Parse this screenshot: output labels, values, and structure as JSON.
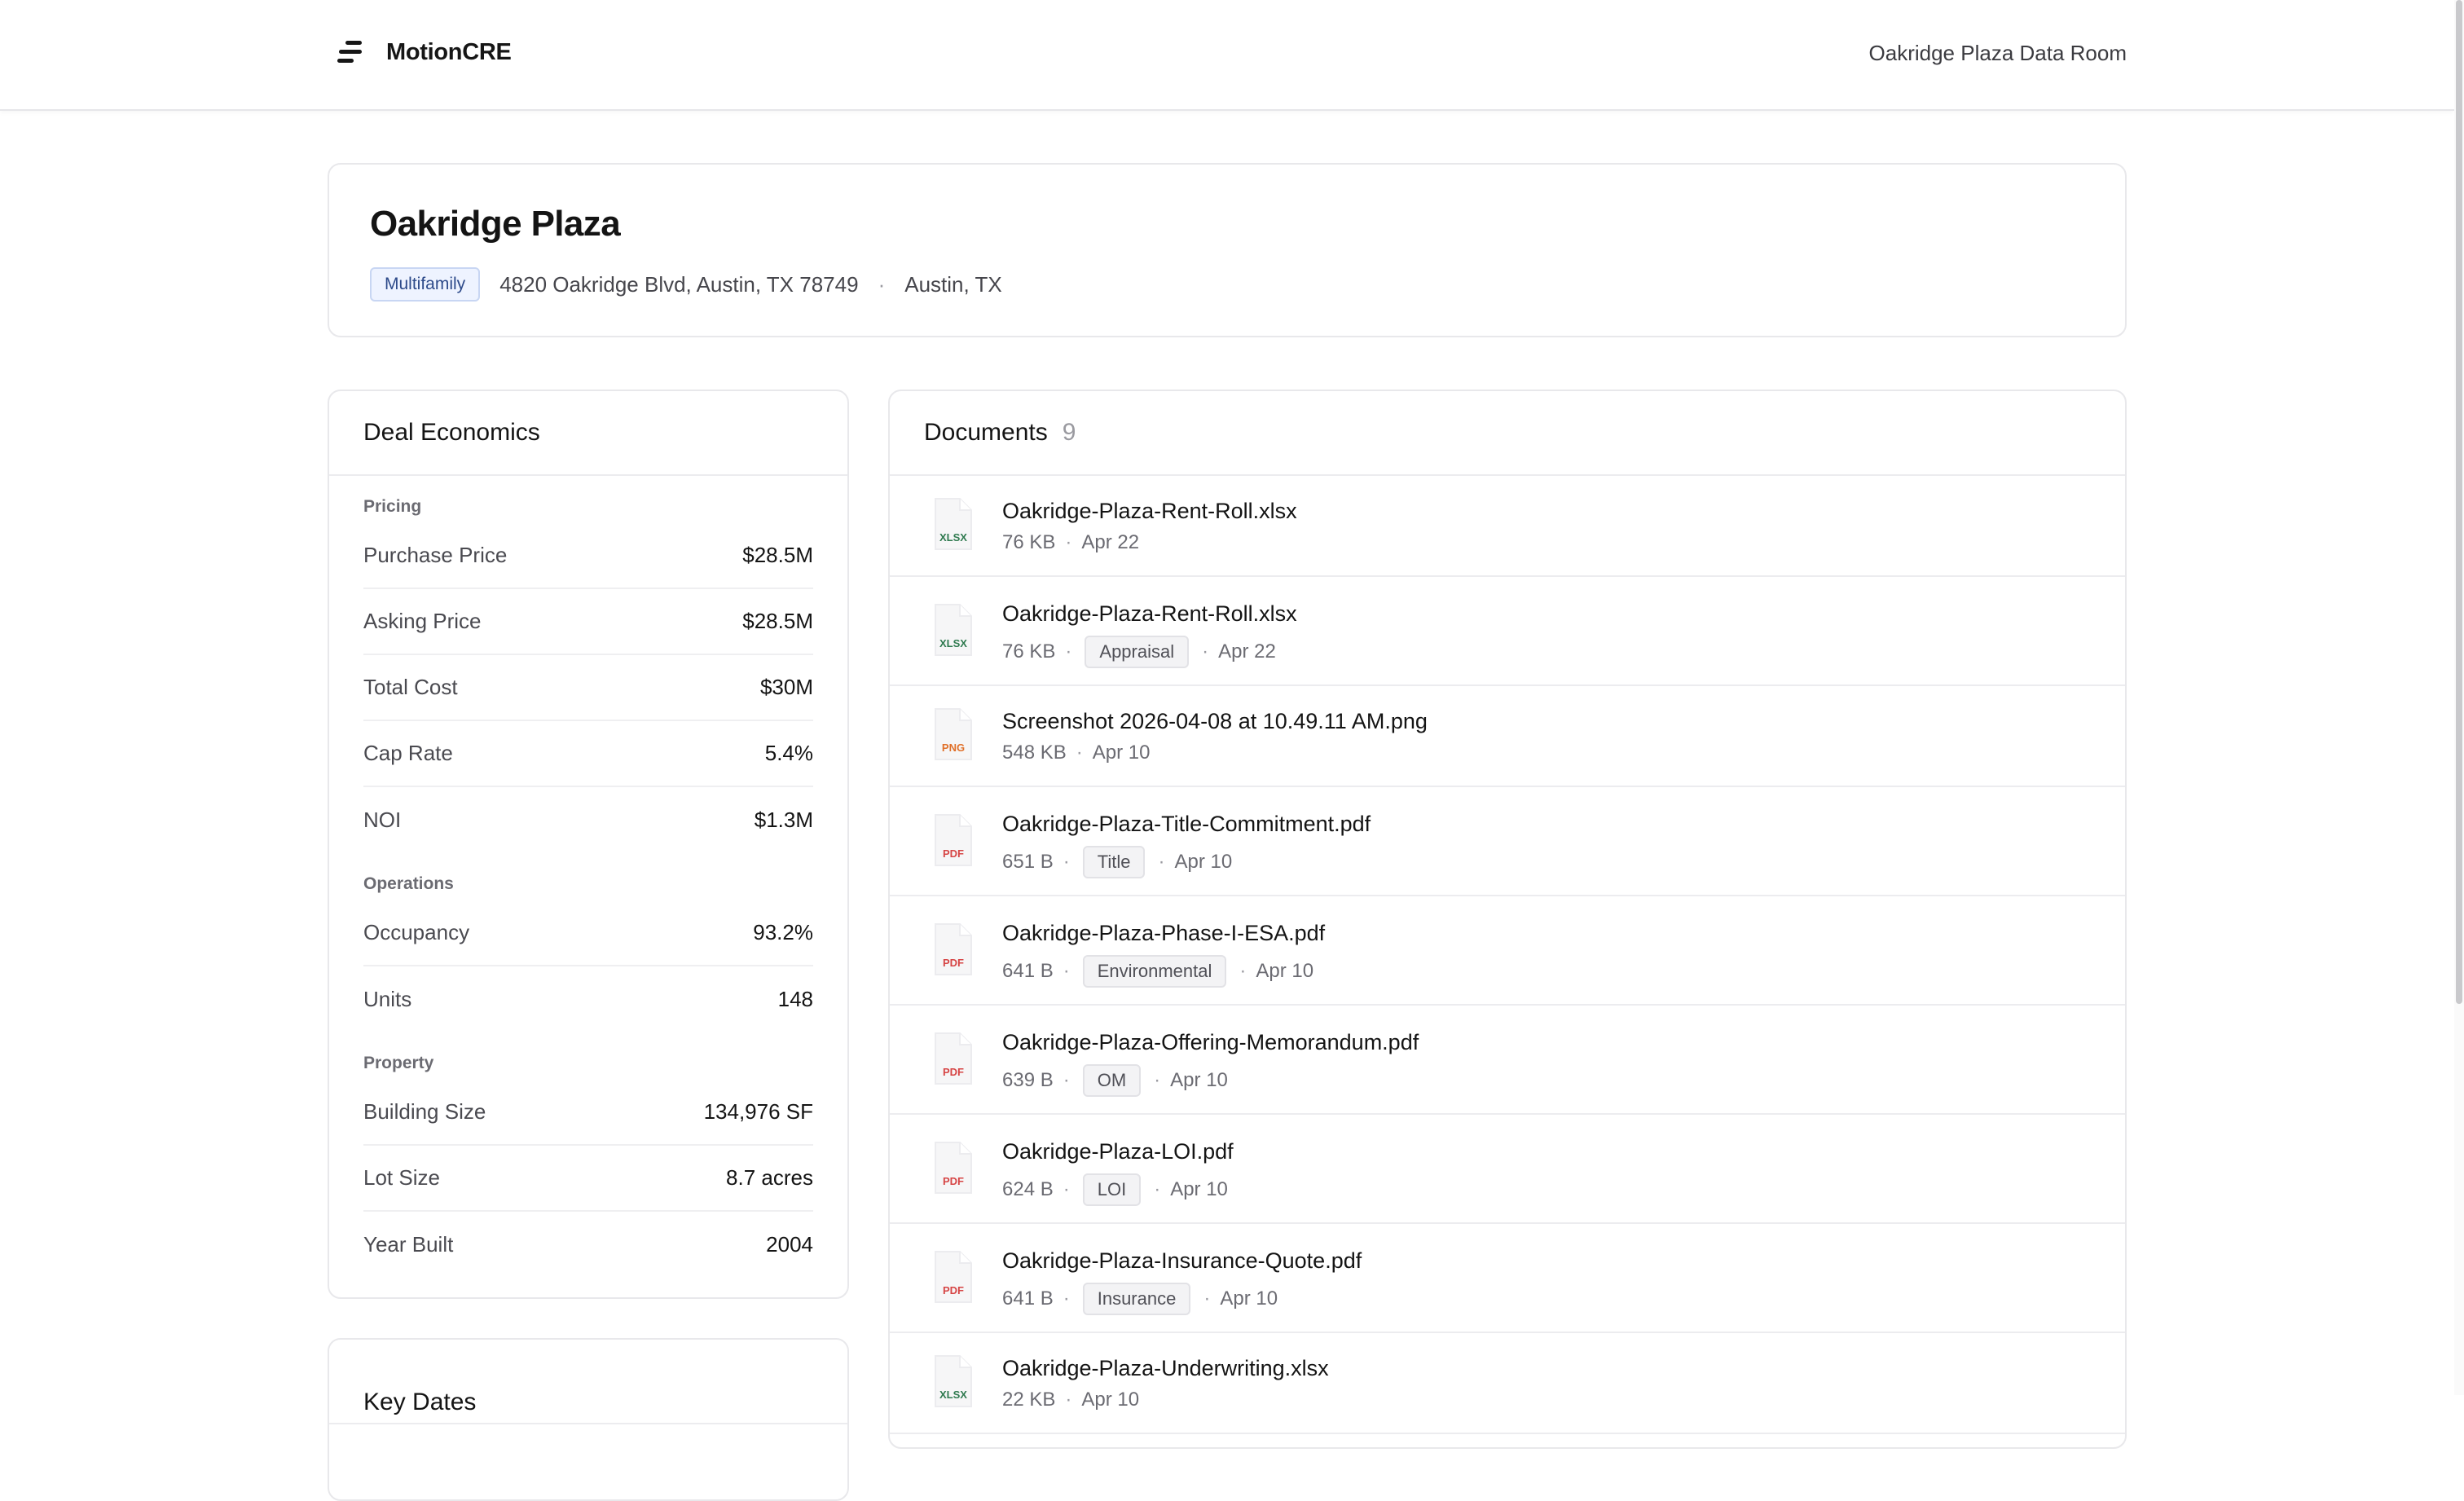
{
  "header": {
    "brand": "MotionCRE",
    "room_title": "Oakridge Plaza Data Room"
  },
  "property": {
    "name": "Oakridge Plaza",
    "type": "Multifamily",
    "address": "4820 Oakridge Blvd, Austin, TX 78749",
    "city": "Austin, TX"
  },
  "deal_economics": {
    "title": "Deal Economics",
    "sections": [
      {
        "label": "Pricing",
        "rows": [
          {
            "label": "Purchase Price",
            "value": "$28.5M"
          },
          {
            "label": "Asking Price",
            "value": "$28.5M"
          },
          {
            "label": "Total Cost",
            "value": "$30M"
          },
          {
            "label": "Cap Rate",
            "value": "5.4%"
          },
          {
            "label": "NOI",
            "value": "$1.3M"
          }
        ]
      },
      {
        "label": "Operations",
        "rows": [
          {
            "label": "Occupancy",
            "value": "93.2%"
          },
          {
            "label": "Units",
            "value": "148"
          }
        ]
      },
      {
        "label": "Property",
        "rows": [
          {
            "label": "Building Size",
            "value": "134,976 SF"
          },
          {
            "label": "Lot Size",
            "value": "8.7 acres"
          },
          {
            "label": "Year Built",
            "value": "2004"
          }
        ]
      }
    ]
  },
  "key_dates": {
    "title": "Key Dates"
  },
  "documents": {
    "title": "Documents",
    "count": "9",
    "items": [
      {
        "name": "Oakridge-Plaza-Rent-Roll.xlsx",
        "size": "76 KB",
        "tag": "",
        "date": "Apr 22",
        "ext": "XLSX",
        "icon": "xlsx-file-icon"
      },
      {
        "name": "Oakridge-Plaza-Rent-Roll.xlsx",
        "size": "76 KB",
        "tag": "Appraisal",
        "date": "Apr 22",
        "ext": "XLSX",
        "icon": "xlsx-file-icon"
      },
      {
        "name": "Screenshot 2026-04-08 at 10.49.11 AM.png",
        "size": "548 KB",
        "tag": "",
        "date": "Apr 10",
        "ext": "PNG",
        "icon": "png-file-icon"
      },
      {
        "name": "Oakridge-Plaza-Title-Commitment.pdf",
        "size": "651 B",
        "tag": "Title",
        "date": "Apr 10",
        "ext": "PDF",
        "icon": "pdf-file-icon"
      },
      {
        "name": "Oakridge-Plaza-Phase-I-ESA.pdf",
        "size": "641 B",
        "tag": "Environmental",
        "date": "Apr 10",
        "ext": "PDF",
        "icon": "pdf-file-icon"
      },
      {
        "name": "Oakridge-Plaza-Offering-Memorandum.pdf",
        "size": "639 B",
        "tag": "OM",
        "date": "Apr 10",
        "ext": "PDF",
        "icon": "pdf-file-icon"
      },
      {
        "name": "Oakridge-Plaza-LOI.pdf",
        "size": "624 B",
        "tag": "LOI",
        "date": "Apr 10",
        "ext": "PDF",
        "icon": "pdf-file-icon"
      },
      {
        "name": "Oakridge-Plaza-Insurance-Quote.pdf",
        "size": "641 B",
        "tag": "Insurance",
        "date": "Apr 10",
        "ext": "PDF",
        "icon": "pdf-file-icon"
      },
      {
        "name": "Oakridge-Plaza-Underwriting.xlsx",
        "size": "22 KB",
        "tag": "",
        "date": "Apr 10",
        "ext": "XLSX",
        "icon": "xlsx-file-icon"
      }
    ]
  },
  "colors": {
    "xlsx": "#2f7a4f",
    "png": "#e0702a",
    "pdf": "#d64545"
  }
}
